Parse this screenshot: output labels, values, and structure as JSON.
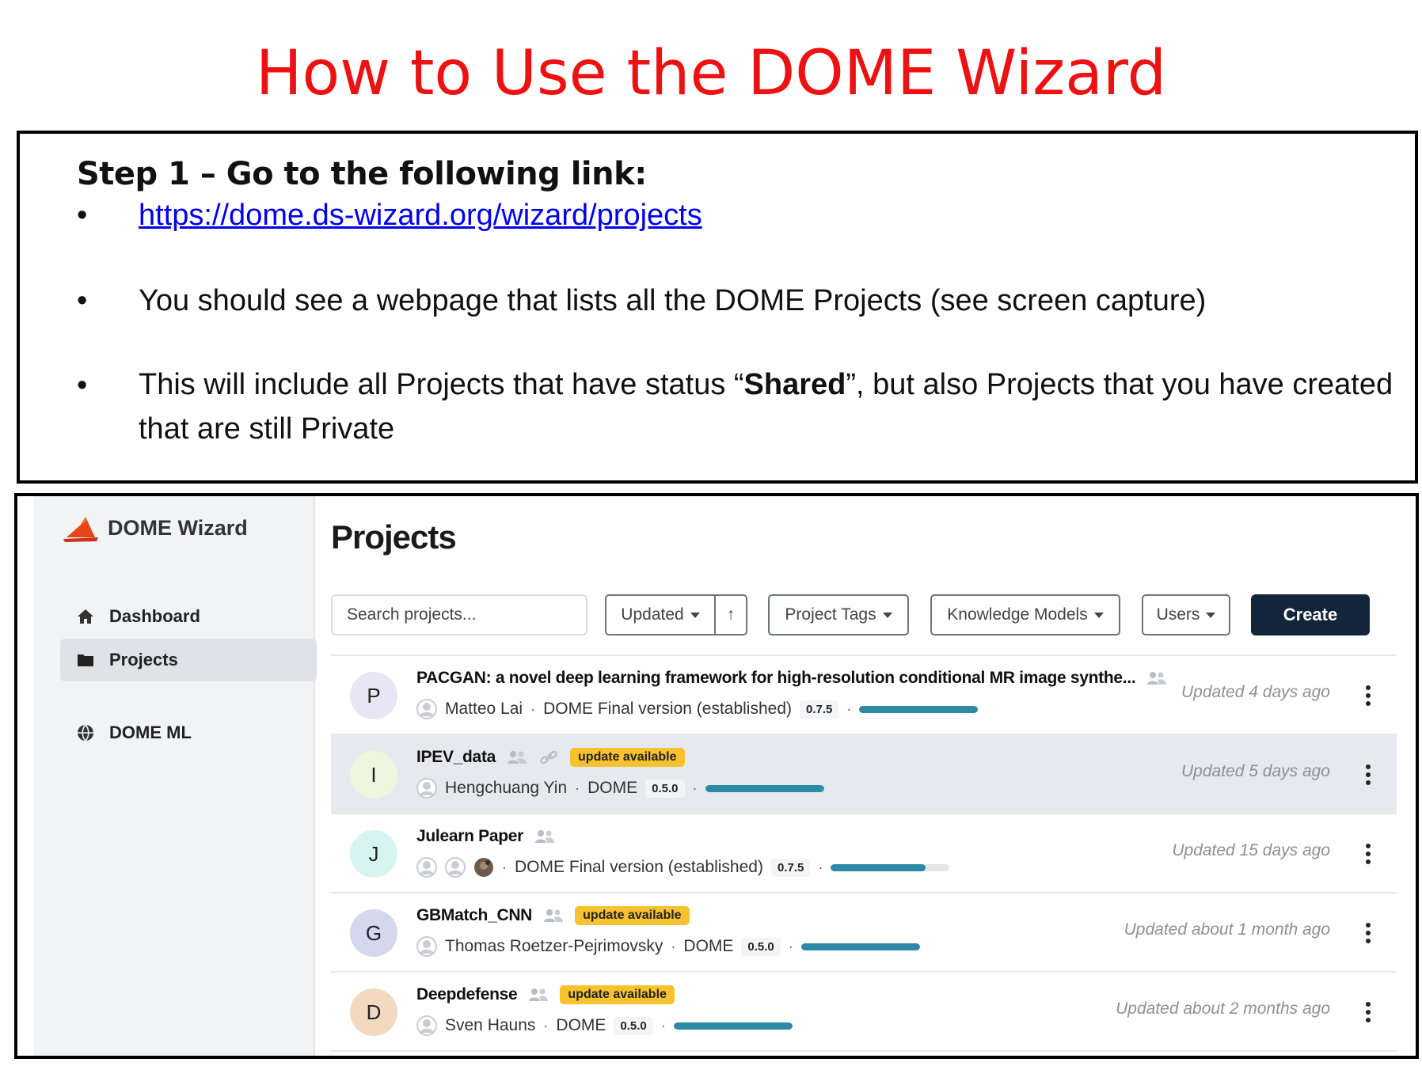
{
  "slide": {
    "title": "How to Use the DOME Wizard",
    "step_heading": "Step 1 – Go to the following link:",
    "bullet_symbol": "•",
    "link": "https://dome.ds-wizard.org/wizard/projects",
    "bullet2": "You should see a webpage that lists all the DOME Projects (see screen capture)",
    "bullet3_pre": "This will include all Projects that have status “",
    "bullet3_bold": "Shared",
    "bullet3_post": "”, but also Projects that you have created that are still Private"
  },
  "app": {
    "brand": "DOME Wizard",
    "nav": [
      {
        "label": "Dashboard",
        "icon": "home-icon"
      },
      {
        "label": "Projects",
        "icon": "folder-icon",
        "active": true
      },
      {
        "label": "DOME ML",
        "icon": "globe-icon"
      }
    ],
    "page_title": "Projects",
    "search_placeholder": "Search projects...",
    "toolbar": {
      "sort_label": "Updated",
      "sort_dir_symbol": "↑",
      "tags_label": "Project Tags",
      "km_label": "Knowledge Models",
      "users_label": "Users",
      "create_label": "Create"
    },
    "colors": {
      "accent": "#13253a",
      "progress": "#2b8aa6",
      "badge": "#f7c230",
      "title_red": "#ee1111"
    },
    "projects": [
      {
        "initial": "P",
        "avatar_color": "#e8e6f5",
        "name": "PACGAN: a novel deep learning framework for high-resolution conditional MR image synthe...",
        "shared": true,
        "link": false,
        "badge": "",
        "owner": "Matteo Lai",
        "owner_count": 1,
        "km": "DOME Final version (established)",
        "version": "0.7.5",
        "progress": 1.0,
        "updated": "Updated 4 days ago"
      },
      {
        "initial": "I",
        "avatar_color": "#eef6df",
        "name": "IPEV_data",
        "shared": true,
        "link": true,
        "badge": "update available",
        "owner": "Hengchuang Yin",
        "owner_count": 1,
        "km": "DOME",
        "version": "0.5.0",
        "progress": 1.0,
        "updated": "Updated 5 days ago"
      },
      {
        "initial": "J",
        "avatar_color": "#d8f4f1",
        "name": "Julearn Paper",
        "shared": true,
        "link": false,
        "badge": "",
        "owner": "",
        "owner_count": 3,
        "km": "DOME Final version (established)",
        "version": "0.7.5",
        "progress": 0.8,
        "updated": "Updated 15 days ago"
      },
      {
        "initial": "G",
        "avatar_color": "#d3d8ef",
        "name": "GBMatch_CNN",
        "shared": true,
        "link": false,
        "badge": "update available",
        "owner": "Thomas Roetzer-Pejrimovsky",
        "owner_count": 1,
        "km": "DOME",
        "version": "0.5.0",
        "progress": 1.0,
        "updated": "Updated about 1 month ago"
      },
      {
        "initial": "D",
        "avatar_color": "#f3d9bf",
        "name": "Deepdefense",
        "shared": true,
        "link": false,
        "badge": "update available",
        "owner": "Sven Hauns",
        "owner_count": 1,
        "km": "DOME",
        "version": "0.5.0",
        "progress": 1.0,
        "updated": "Updated about 2 months ago"
      }
    ]
  }
}
